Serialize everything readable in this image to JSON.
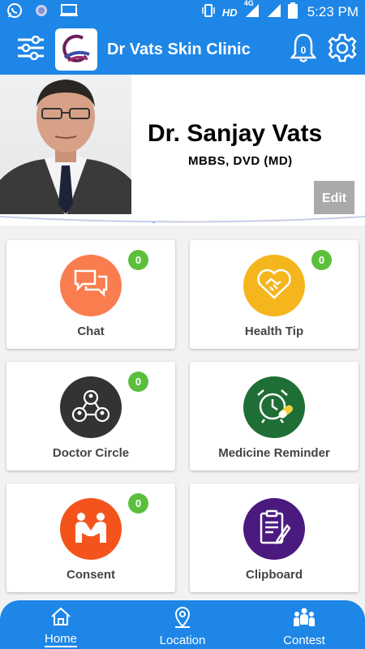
{
  "status_bar": {
    "network": "HD",
    "signal_label": "4G",
    "time": "5:23 PM"
  },
  "app_bar": {
    "title": "Dr Vats Skin Clinic",
    "notification_count": "0"
  },
  "profile": {
    "name": "Dr. Sanjay Vats",
    "degree": "MBBS, DVD (MD)",
    "edit_label": "Edit"
  },
  "carousel": {
    "page_count": 5,
    "active_index": 0
  },
  "tiles": [
    {
      "label": "Chat",
      "badge": "0",
      "color": "#f97d4f",
      "icon": "chat-bubbles-icon"
    },
    {
      "label": "Health Tip",
      "badge": "0",
      "color": "#f5b51c",
      "icon": "heart-handshake-icon"
    },
    {
      "label": "Doctor Circle",
      "badge": "0",
      "color": "#333333",
      "icon": "doctor-circle-icon"
    },
    {
      "label": "Medicine Reminder",
      "badge": "",
      "color": "#1e6e35",
      "icon": "alarm-clock-pill-icon"
    },
    {
      "label": "Consent",
      "badge": "0",
      "color": "#f4541c",
      "icon": "handshake-icon"
    },
    {
      "label": "Clipboard",
      "badge": "",
      "color": "#4a1a7e",
      "icon": "clipboard-icon"
    }
  ],
  "bottom_nav": [
    {
      "label": "Home",
      "icon": "home-icon"
    },
    {
      "label": "Location",
      "icon": "location-pin-icon"
    },
    {
      "label": "Contest",
      "icon": "contest-people-icon"
    }
  ],
  "colors": {
    "primary": "#1e86e6",
    "badge": "#5bbf3c",
    "edit_button": "#aaaaaa"
  }
}
